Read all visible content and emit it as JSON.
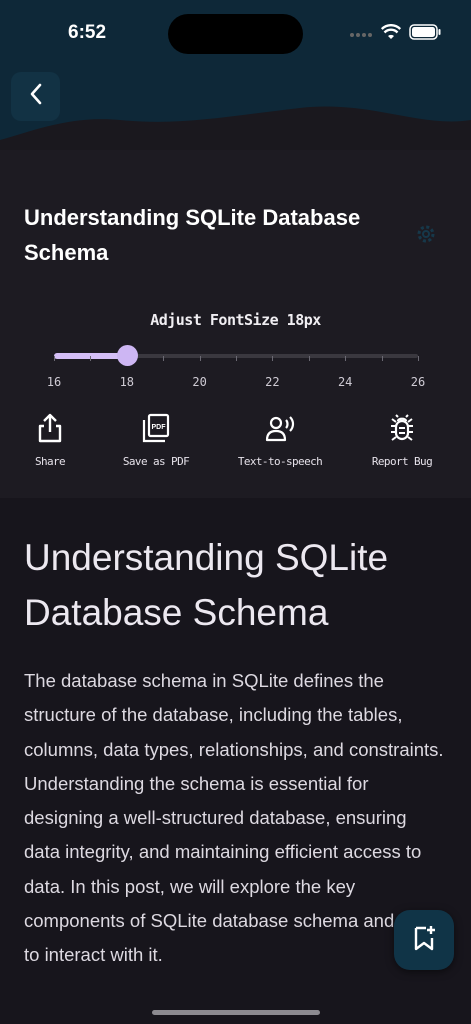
{
  "status_bar": {
    "time": "6:52"
  },
  "header": {
    "back_icon": "chevron-left-icon"
  },
  "post": {
    "title": "Understanding SQLite Database Schema",
    "settings_icon": "gear-icon"
  },
  "font_size": {
    "label": "Adjust FontSize 18px",
    "min": 16,
    "max": 26,
    "value": 18,
    "tick_labels": [
      "16",
      "18",
      "20",
      "22",
      "24",
      "26"
    ]
  },
  "actions": [
    {
      "label": "Share",
      "icon": "share-icon"
    },
    {
      "label": "Save as PDF",
      "icon": "pdf-icon"
    },
    {
      "label": "Text-to-speech",
      "icon": "speaker-icon"
    },
    {
      "label": "Report Bug",
      "icon": "bug-icon"
    }
  ],
  "article": {
    "heading": "Understanding SQLite Database Schema",
    "body": "The database schema in SQLite defines the structure of the database, including the tables, columns, data types, relationships, and constraints. Understanding the schema is essential for designing a well-structured database, ensuring data integrity, and maintaining efficient access to data. In this post, we will explore the key components of SQLite database schema and how to interact with it."
  },
  "fab": {
    "icon": "bookmark-add-icon"
  },
  "colors": {
    "accent": "#cdb6f3",
    "header": "#0e2838",
    "panel": "#1d1b22",
    "background": "#17151c"
  }
}
